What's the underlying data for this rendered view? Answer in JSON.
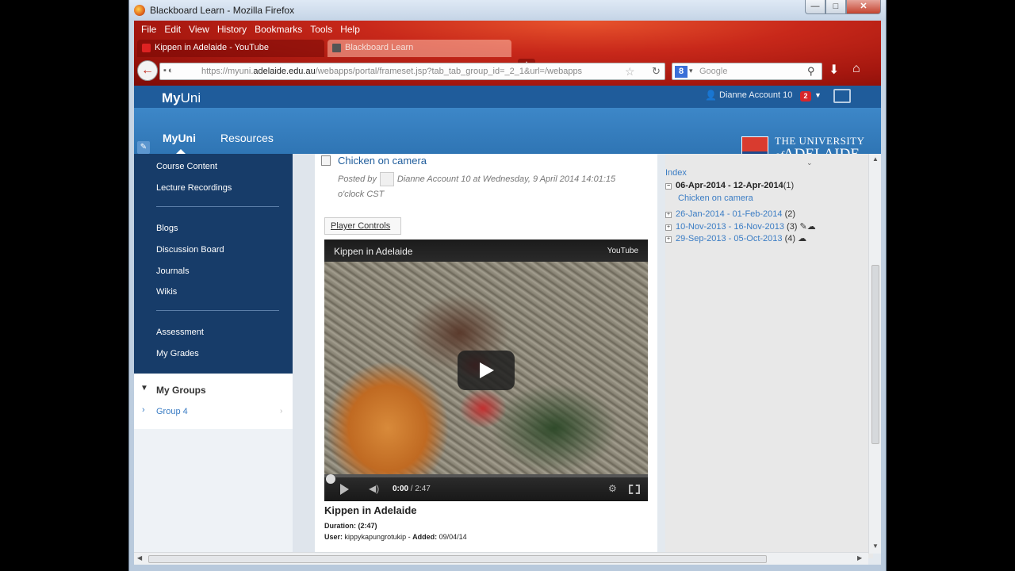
{
  "window": {
    "title": "Blackboard Learn - Mozilla Firefox",
    "minimize": "—",
    "maximize": "□",
    "close": "✕"
  },
  "menu": [
    "File",
    "Edit",
    "View",
    "History",
    "Bookmarks",
    "Tools",
    "Help"
  ],
  "tabs": [
    {
      "label": "Kippen in Adelaide - YouTube",
      "icon": "youtube-favicon"
    },
    {
      "label": "Blackboard Learn",
      "icon": "blackboard-favicon"
    }
  ],
  "new_tab": "+",
  "address": {
    "prefix": "https://myuni.",
    "domain": "adelaide.edu.au",
    "path": "/webapps/portal/frameset.jsp?tab_tab_group_id=_2_1&url=/webapps",
    "search_engine": "8",
    "search_placeholder": "Google"
  },
  "site": {
    "brand_bold": "My",
    "brand_rest": "Uni",
    "user": "Dianne Account 10",
    "notifications": "2",
    "nav": [
      "MyUni",
      "Resources"
    ],
    "logo_line1": "THE UNIVERSITY",
    "logo_of": "of",
    "logo_line2": "ADELAIDE"
  },
  "sidebar": {
    "group1": [
      "Course Content",
      "Lecture Recordings"
    ],
    "group2": [
      "Blogs",
      "Discussion Board",
      "Journals",
      "Wikis"
    ],
    "group3": [
      "Assessment",
      "My Grades"
    ],
    "groups_title": "My Groups",
    "group_item": "Group 4"
  },
  "post": {
    "title": "Chicken on camera",
    "posted_by": "Posted by",
    "author": "Dianne Account 10",
    "date": "at Wednesday, 9 April 2014 14:01:15",
    "date_cont": "o'clock CST",
    "player_controls": "Player Controls"
  },
  "video": {
    "title": "Kippen in Adelaide",
    "brand": "YouTube",
    "time_current": "0:00",
    "time_total": " / 2:47",
    "progress": 0,
    "caption": "Kippen in Adelaide",
    "duration": "Duration: (2:47)",
    "user_label": "User:",
    "user": "kippykapungrotukip",
    "added_label": "Added:",
    "added": "09/04/14"
  },
  "archive": {
    "index": "Index",
    "current_week": "06-Apr-2014 - 12-Apr-2014",
    "current_count": "(1)",
    "current_entry": "Chicken on camera",
    "weeks": [
      {
        "range": "26-Jan-2014 - 01-Feb-2014",
        "count": "(2)"
      },
      {
        "range": "10-Nov-2013 - 16-Nov-2013",
        "count": "(3)"
      },
      {
        "range": "29-Sep-2013 - 05-Oct-2013",
        "count": "(4)"
      }
    ]
  }
}
